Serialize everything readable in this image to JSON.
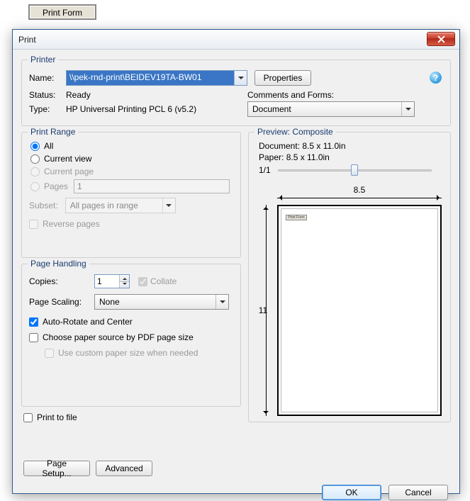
{
  "print_form_button": "Print Form",
  "dialog": {
    "title": "Print",
    "close_icon": "close-icon"
  },
  "printer": {
    "group_title": "Printer",
    "name_label": "Name:",
    "name_value": "\\\\pek-rnd-print\\BEIDEV19TA-BW01",
    "properties_button": "Properties",
    "status_label": "Status:",
    "status_value": "Ready",
    "type_label": "Type:",
    "type_value": "HP Universal Printing PCL 6 (v5.2)",
    "comments_forms_label": "Comments and Forms:",
    "comments_forms_value": "Document"
  },
  "range": {
    "group_title": "Print Range",
    "all": "All",
    "current_view": "Current view",
    "current_page": "Current page",
    "pages": "Pages",
    "pages_value": "1",
    "subset_label": "Subset:",
    "subset_value": "All pages in range",
    "reverse_pages": "Reverse pages",
    "selected": "all"
  },
  "handling": {
    "group_title": "Page Handling",
    "copies_label": "Copies:",
    "copies_value": "1",
    "collate": "Collate",
    "scaling_label": "Page Scaling:",
    "scaling_value": "None",
    "auto_rotate": "Auto-Rotate and Center",
    "choose_paper": "Choose paper source by PDF page size",
    "use_custom": "Use custom paper size when needed"
  },
  "print_to_file": "Print to file",
  "preview": {
    "group_title": "Preview: Composite",
    "doc_size": "Document: 8.5 x 11.0in",
    "paper_size": "Paper: 8.5 x 11.0in",
    "page_indicator": "1/1",
    "width_dim": "8.5",
    "height_dim": "11",
    "mini_button": "Print Form"
  },
  "buttons": {
    "page_setup": "Page Setup...",
    "advanced": "Advanced",
    "ok": "OK",
    "cancel": "Cancel"
  }
}
